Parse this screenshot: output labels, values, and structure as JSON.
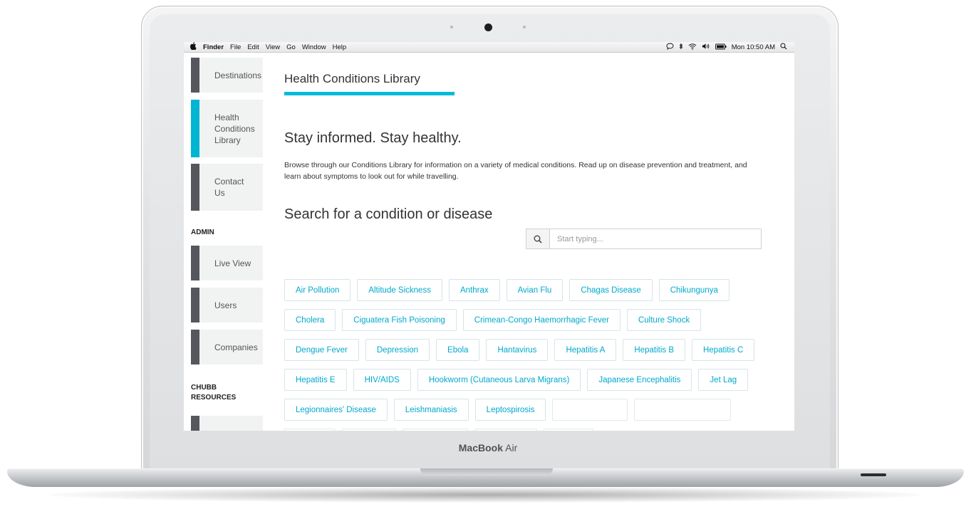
{
  "device": {
    "brand_bold": "MacBook",
    "brand_light": " Air"
  },
  "menubar": {
    "apple_icon": "apple-icon",
    "app": "Finder",
    "items": [
      "File",
      "Edit",
      "View",
      "Go",
      "Window",
      "Help"
    ],
    "status_icons": [
      "notification-icon",
      "bluetooth-icon",
      "wifi-icon",
      "volume-icon",
      "battery-icon"
    ],
    "clock": "Mon 10:50 AM",
    "spotlight_icon": "search-icon"
  },
  "sidebar": {
    "items": [
      {
        "label": "Destinations",
        "active": false
      },
      {
        "label": "Health Conditions Library",
        "active": true
      },
      {
        "label": "Contact Us",
        "active": false
      }
    ],
    "admin_label": "ADMIN",
    "admin_items": [
      {
        "label": "Live View"
      },
      {
        "label": "Users"
      },
      {
        "label": "Companies"
      }
    ],
    "resources_label": "CHUBB RESOURCES"
  },
  "main": {
    "title": "Health Conditions Library",
    "subhead": "Stay informed. Stay healthy.",
    "intro": "Browse through our Conditions Library for information on a variety of medical conditions. Read up on disease prevention and treatment, and learn about symptoms to look out for while travelling.",
    "search_heading": "Search for a condition or disease",
    "search_placeholder": "Start typing...",
    "search_value": "",
    "conditions": [
      "Air Pollution",
      "Altitude Sickness",
      "Anthrax",
      "Avian Flu",
      "Chagas Disease",
      "Chikungunya",
      "Cholera",
      "Ciguatera Fish Poisoning",
      "Crimean-Congo Haemorrhagic Fever",
      "Culture Shock",
      "Dengue Fever",
      "Depression",
      "Ebola",
      "Hantavirus",
      "Hepatitis A",
      "Hepatitis B",
      "Hepatitis C",
      "Hepatitis E",
      "HIV/AIDS",
      "Hookworm (Cutaneous Larva Migrans)",
      "Japanese Encephalitis",
      "Jet Lag",
      "Legionnaires' Disease",
      "Leishmaniasis",
      "Leptospirosis"
    ]
  },
  "colors": {
    "accent": "#00bcd8",
    "nav_bar": "#55575c",
    "nav_bg": "#f1f2f2",
    "tag_text": "#00a9cc"
  }
}
